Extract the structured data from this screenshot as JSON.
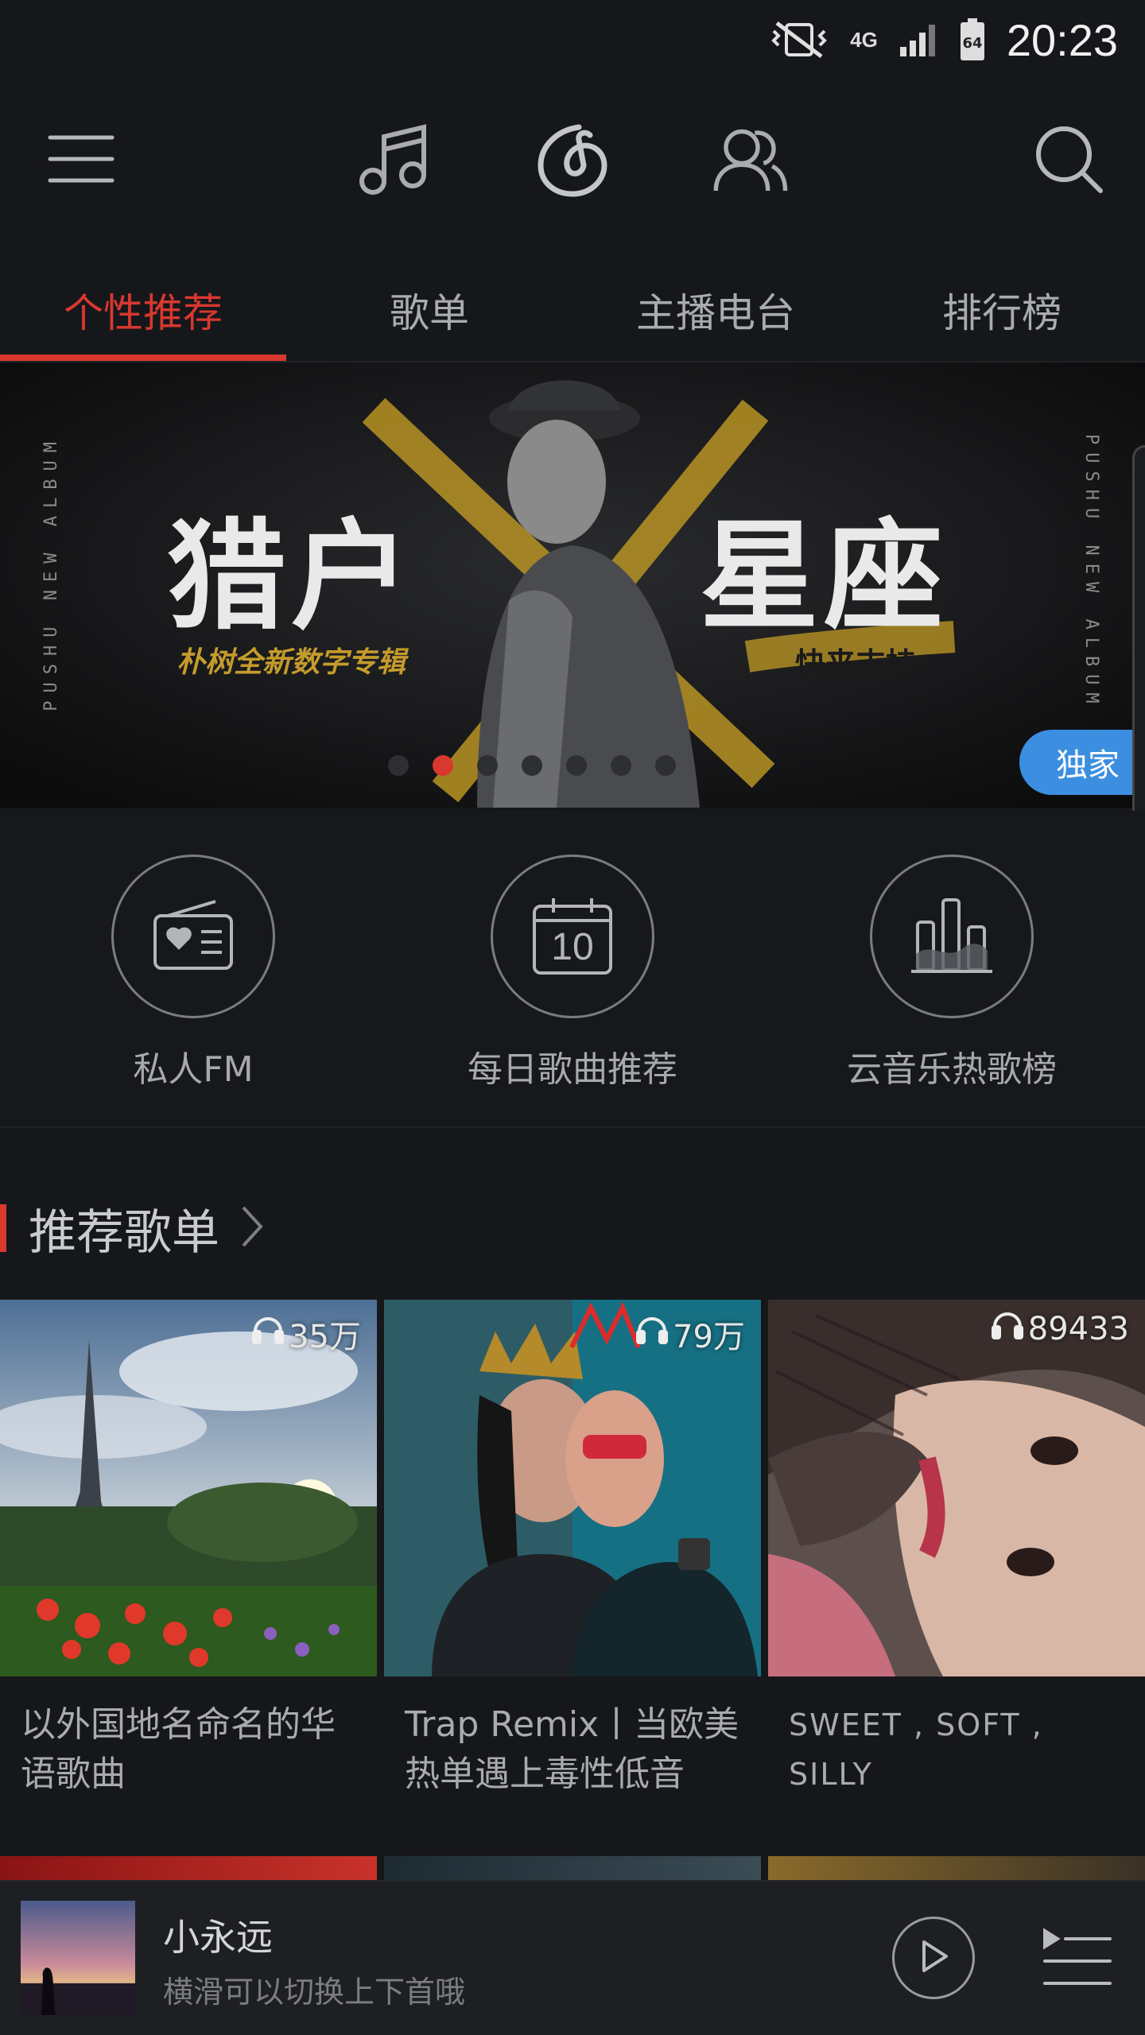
{
  "status_bar": {
    "time": "20:23",
    "network": "4G",
    "battery": "64",
    "icons": [
      "vibrate-mute-icon",
      "network-4g-icon",
      "signal-icon",
      "battery-icon"
    ]
  },
  "top_nav": {
    "icons": [
      "menu-icon",
      "music-icon",
      "netease-logo-icon",
      "friends-icon",
      "search-icon"
    ]
  },
  "tabs": [
    {
      "label": "个性推荐",
      "active": true
    },
    {
      "label": "歌单",
      "active": false
    },
    {
      "label": "主播电台",
      "active": false
    },
    {
      "label": "排行榜",
      "active": false
    }
  ],
  "banner": {
    "title_left": "猎户",
    "title_right": "星座",
    "subtitle": "朴树全新数字专辑",
    "cta": "快来支持",
    "side_text": "PUSHU NEW ALBUM",
    "badge": "独家",
    "dot_count": 7,
    "active_dot": 1
  },
  "quick_access": [
    {
      "label": "私人FM",
      "icon": "radio-heart-icon"
    },
    {
      "label": "每日歌曲推荐",
      "icon": "calendar-icon",
      "day": "10"
    },
    {
      "label": "云音乐热歌榜",
      "icon": "bar-chart-icon"
    }
  ],
  "section": {
    "title": "推荐歌单"
  },
  "playlists": [
    {
      "plays": "35万",
      "title": "以外国地名命名的华语歌曲"
    },
    {
      "plays": "79万",
      "title": "Trap Remix丨当欧美热单遇上毒性低音"
    },
    {
      "plays": "89433",
      "title": "SWEET , SOFT , SILLY"
    }
  ],
  "mini_player": {
    "song": "小永远",
    "hint": "横滑可以切换上下首哦"
  },
  "colors": {
    "accent": "#d8382e",
    "background": "#16171b",
    "badge": "#3c8fe0"
  }
}
